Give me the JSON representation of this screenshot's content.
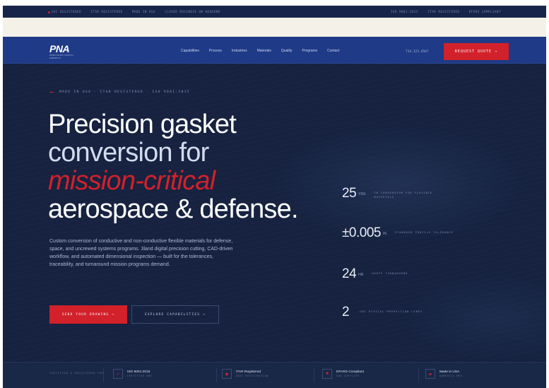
{
  "topbar": {
    "left": [
      "SEC REGISTERED",
      "ITAR REGISTERED",
      "MADE IN USA",
      "CLOSED BUSINESS ON WEEKEND"
    ],
    "right": [
      "ISO 9001:2015",
      "ITAR REGISTERED",
      "DFARS COMPLIANT"
    ]
  },
  "nav": {
    "logo": "PNA",
    "logo_sub": "PRECISION NORTH AMERICA",
    "links": [
      "Capabilities",
      "Process",
      "Industries",
      "Materials",
      "Quality",
      "Programs",
      "Contact"
    ],
    "phone": "714.123.4567",
    "cta": "REQUEST QUOTE →"
  },
  "hero": {
    "eyebrow": "MADE IN USA · ITAR REGISTERED · ISO 9001:2015",
    "headline": {
      "line1": "Precision gasket",
      "line2": "conversion for",
      "line3": "mission-critical",
      "line4": "aerospace & defense."
    },
    "lede": "Custom conversion of conductive and non-conductive flexible materials for defense, space, and uncrewed systems programs. 3land digital precision cutting, CAD-driven workflow, and automated dimensional inspection — built for the tolerances, traceability, and turnaround mission programs demand.",
    "primary_cta": "SEND YOUR DRAWING →",
    "secondary_cta": "EXPLORE CAPABILITIES →"
  },
  "stats": [
    {
      "value": "25",
      "unit": "YRS",
      "label": "IN CONVERSION FOR FLEXIBLE MATERIALS"
    },
    {
      "value": "±0.005",
      "unit": "IN",
      "label": "STANDARD PROFILE TOLERANCE"
    },
    {
      "value": "24",
      "unit": "HR",
      "label": "QUOTE TURNAROUND"
    },
    {
      "value": "2",
      "unit": "",
      "label": "CNC DIGITAL PRODUCTION LINES"
    }
  ],
  "certifications": {
    "intro": "CERTIFIED & REGISTERED FOR",
    "items": [
      {
        "name": "ISO 9001:2015",
        "sub": "CERTIFIED QMS",
        "icon": "check-icon"
      },
      {
        "name": "ITAR Registered",
        "sub": "DDTC REGISTRATION",
        "icon": "shield-icon"
      },
      {
        "name": "DFARS Compliant",
        "sub": "DOD SUPPLIER",
        "icon": "lock-icon"
      },
      {
        "name": "Made in USA",
        "sub": "DOMESTIC MFG",
        "icon": "flag-icon"
      }
    ]
  },
  "colors": {
    "accent_red": "#d2212b",
    "nav_blue": "#1f3a86",
    "hero_navy": "#16223f"
  }
}
